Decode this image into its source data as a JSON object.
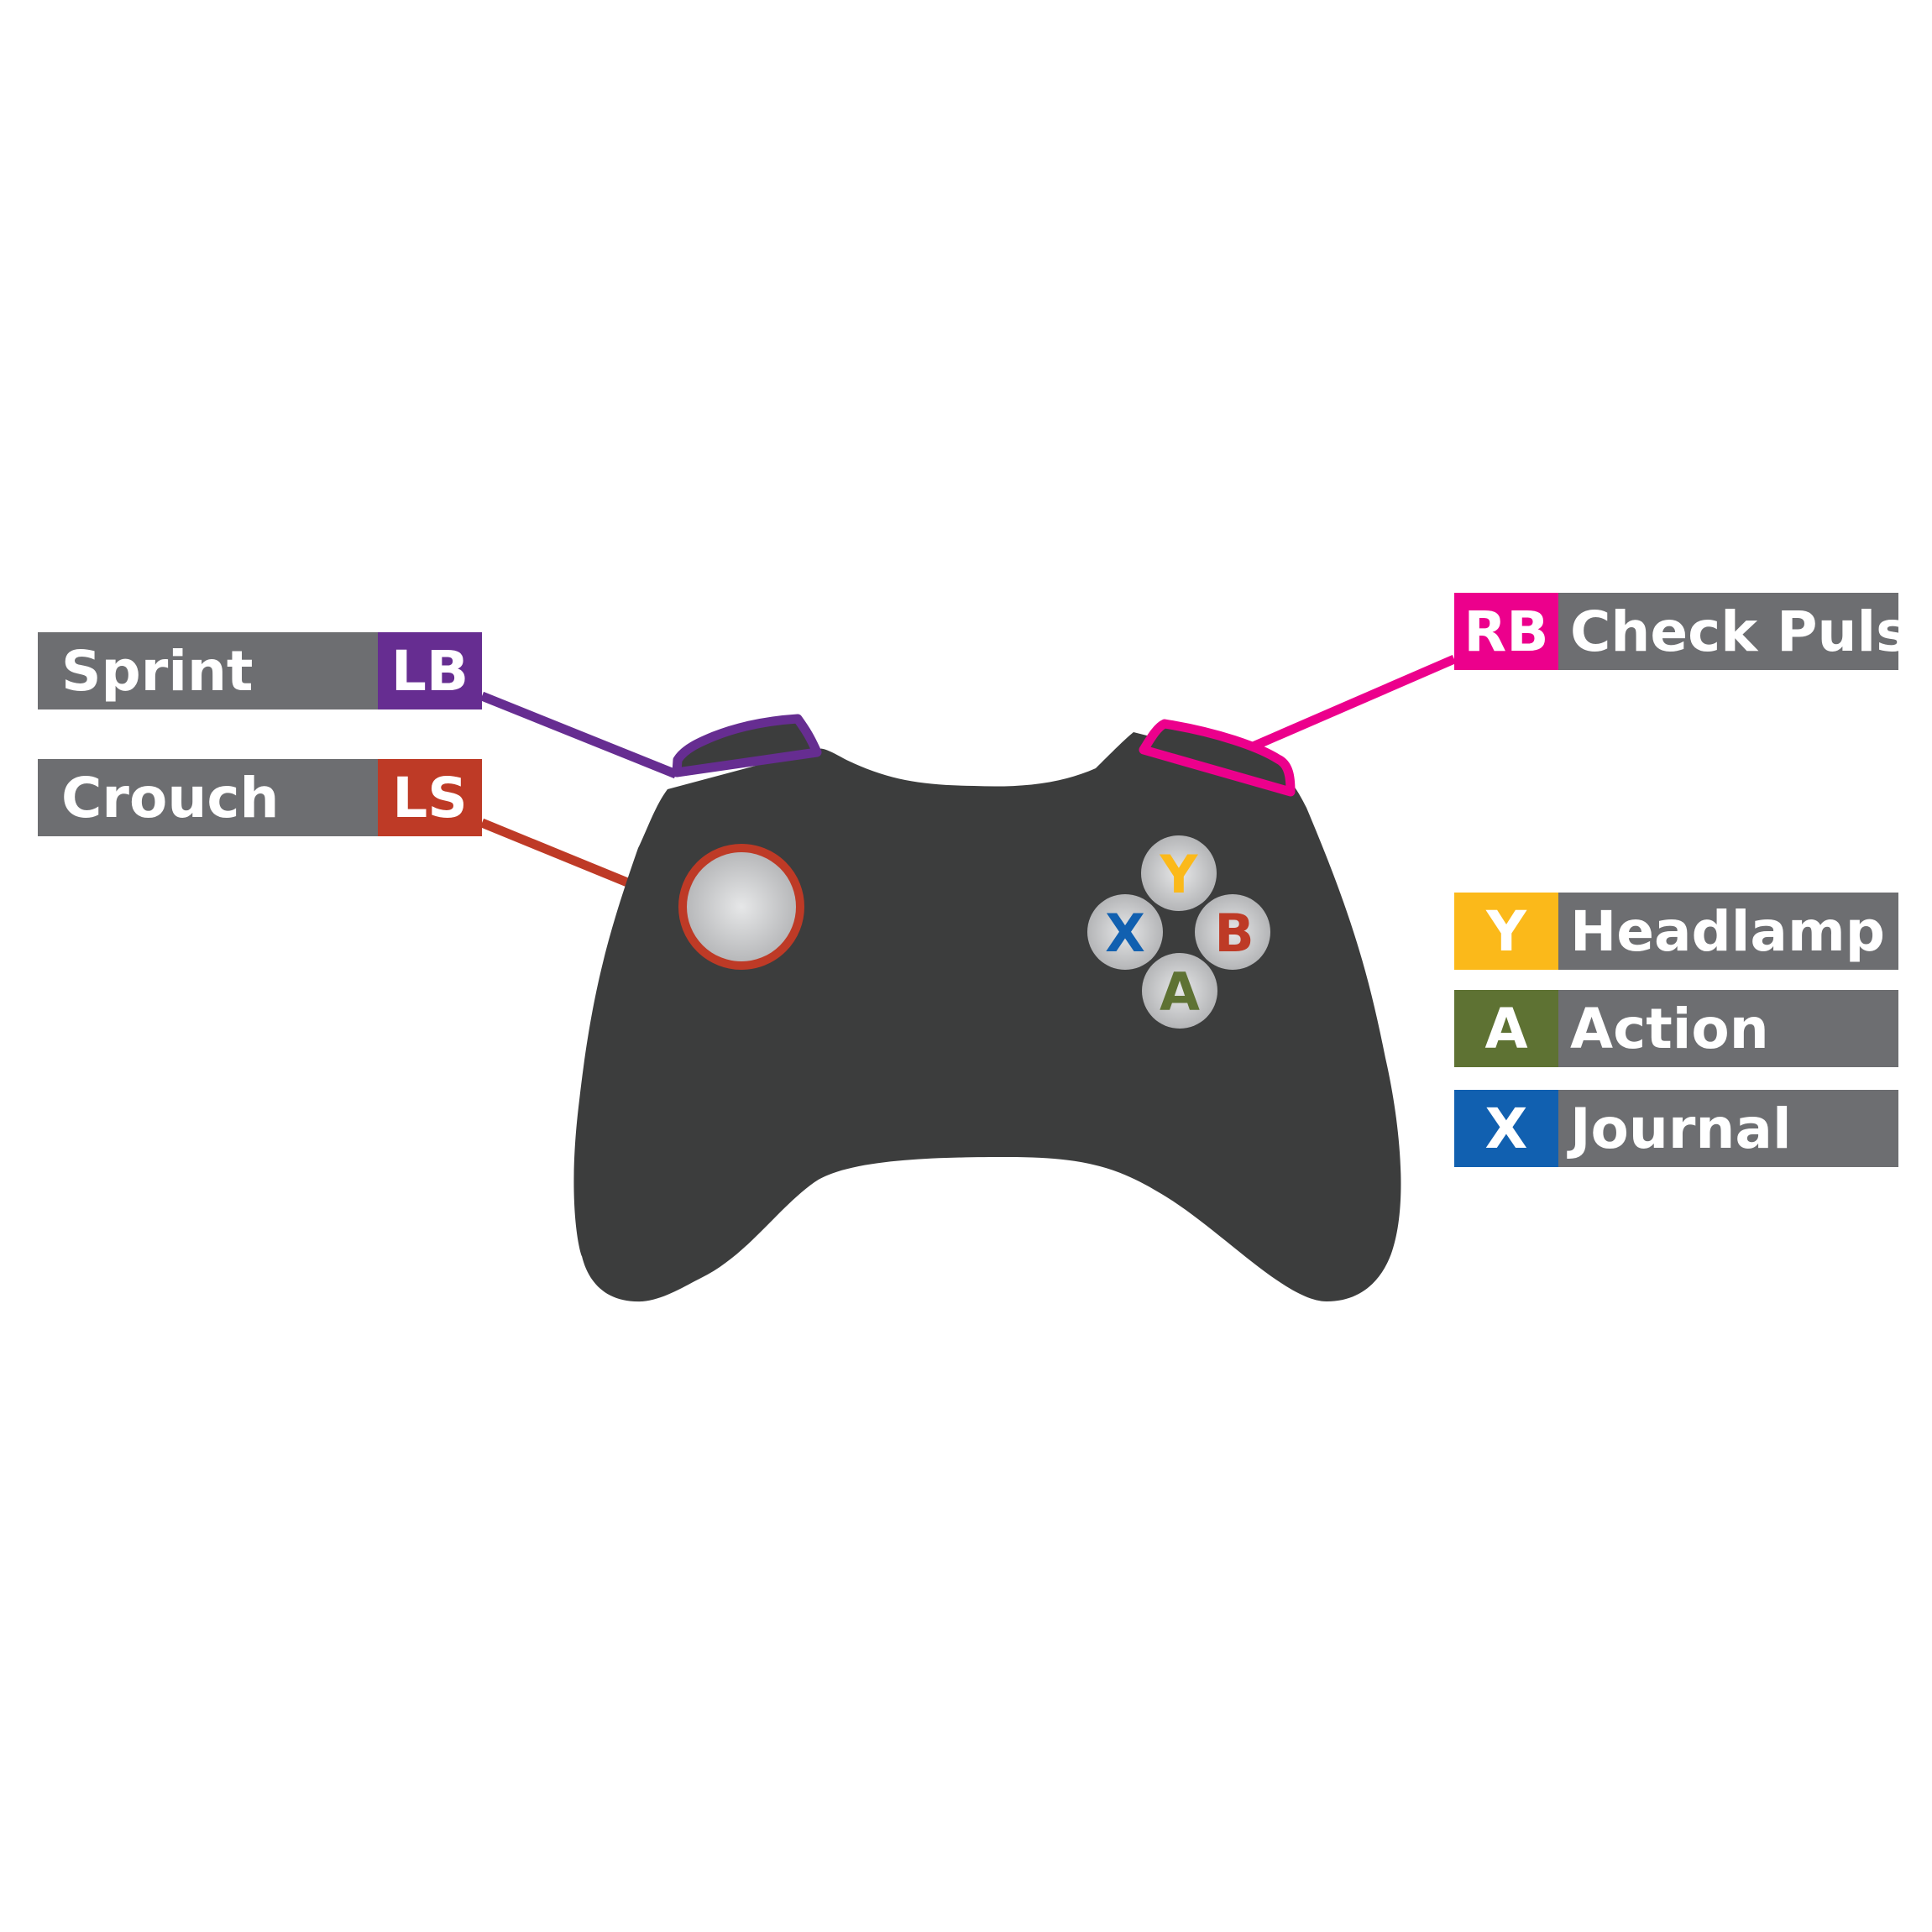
{
  "colors": {
    "controller": "#3c3d3d",
    "label_bg": "#6d6e71",
    "lb": "#662d91",
    "ls": "#be3a26",
    "rb": "#ec008c",
    "y": "#fbb91a",
    "a": "#5e7233",
    "x": "#1160b0",
    "b": "#be3a26",
    "button_face": "#c7c8ca"
  },
  "face_buttons": {
    "y": "Y",
    "x": "X",
    "b": "B",
    "a": "A"
  },
  "mappings": {
    "lb": {
      "key": "LB",
      "action": "Sprint"
    },
    "ls": {
      "key": "LS",
      "action": "Crouch"
    },
    "rb": {
      "key": "RB",
      "action": "Check Pulse"
    },
    "y": {
      "key": "Y",
      "action": "Headlamp"
    },
    "a": {
      "key": "A",
      "action": "Action"
    },
    "x": {
      "key": "X",
      "action": "Journal"
    }
  }
}
